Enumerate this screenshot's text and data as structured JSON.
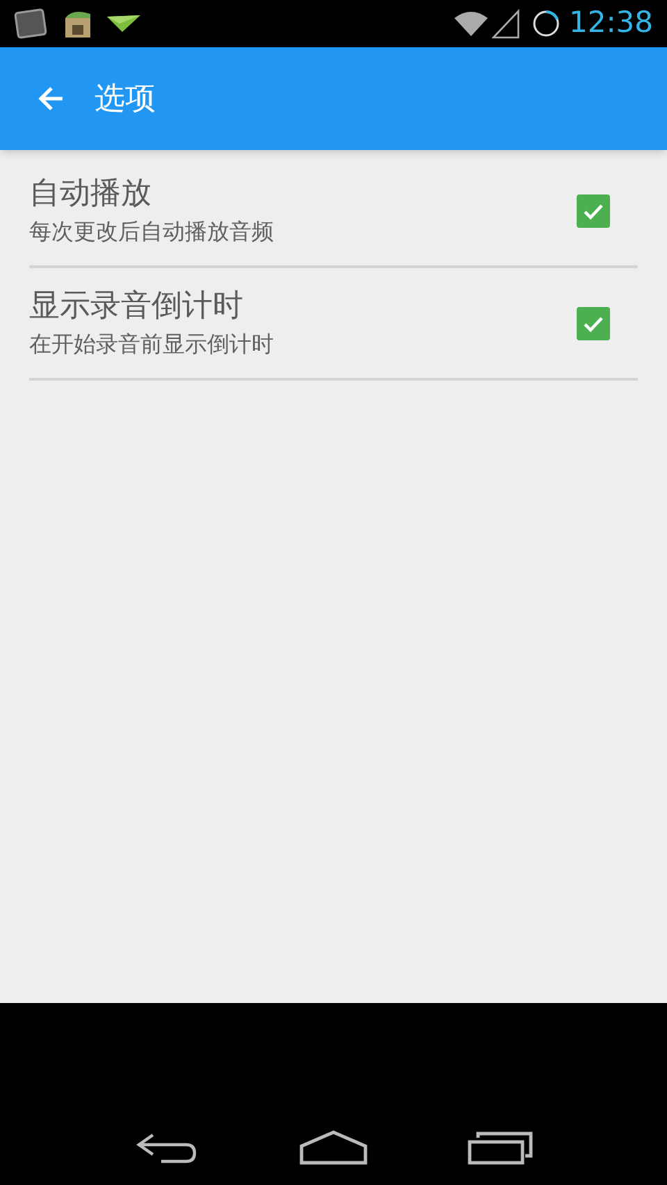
{
  "status_bar": {
    "time": "12:38"
  },
  "app_bar": {
    "title": "选项"
  },
  "settings": [
    {
      "title": "自动播放",
      "summary": "每次更改后自动播放音频",
      "checked": true
    },
    {
      "title": "显示录音倒计时",
      "summary": "在开始录音前显示倒计时",
      "checked": true
    }
  ]
}
